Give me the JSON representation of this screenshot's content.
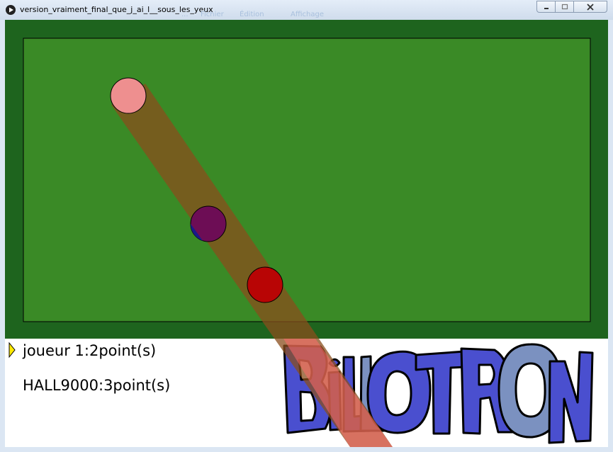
{
  "window": {
    "title": "version_vraiment_final_que_j_ai_l__sous_les_yeux",
    "menu_ghost": [
      "...",
      "Fichier",
      "Édition",
      "Affichage"
    ]
  },
  "scoreboard": {
    "player1": "joueur 1:2point(s)",
    "player2": "HALL9000:3point(s)",
    "active_player": 1
  },
  "logo": {
    "text": "BILLOTRON",
    "letter_colors": [
      "#4a4fcf",
      "#4a4fcf",
      "#4a4fcf",
      "#4a4fcf",
      "#7b91c0",
      "#4a4fcf",
      "#4a4fcf",
      "#7b91c0",
      "#4a4fcf"
    ]
  },
  "colors": {
    "frame": "#1e641e",
    "felt": "#3a8a26",
    "aim_beam": "#8a4e1c",
    "pink_ball": "#ee8f8f",
    "purple_ball": "#6d0d55",
    "red_ball": "#b80505",
    "active_marker": "#ffea00"
  },
  "balls": [
    {
      "name": "pink",
      "color": "#ee8f8f"
    },
    {
      "name": "purple",
      "color": "#6d0d55"
    },
    {
      "name": "red",
      "color": "#b80505"
    }
  ]
}
